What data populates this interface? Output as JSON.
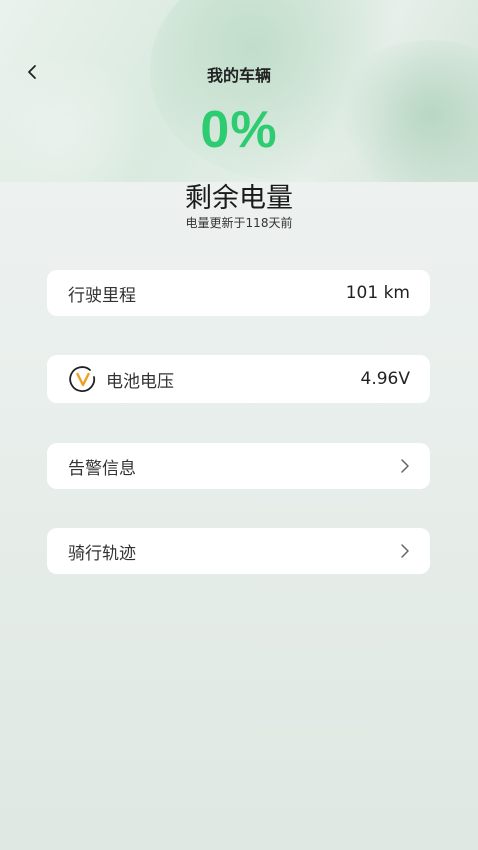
{
  "header": {
    "title": "我的车辆"
  },
  "battery": {
    "percent": "0%",
    "label": "剩余电量",
    "updated_text": "电量更新于118天前",
    "accent_color": "#2ecc71"
  },
  "cards": {
    "mileage": {
      "label": "行驶里程",
      "value": "101 km"
    },
    "voltage": {
      "label": "电池电压",
      "value": "4.96V",
      "icon": "voltage-icon",
      "icon_color": "#f0a020"
    },
    "alerts": {
      "label": "告警信息",
      "icon": "chevron-right-icon"
    },
    "track": {
      "label": "骑行轨迹",
      "icon": "chevron-right-icon"
    }
  }
}
